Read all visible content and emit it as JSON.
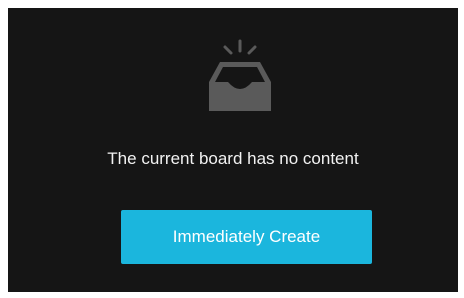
{
  "empty_state": {
    "icon": "empty-inbox-icon",
    "message": "The current board has no content",
    "create_button_label": "Immediately Create"
  },
  "colors": {
    "background": "#151515",
    "icon": "#5a5a5a",
    "button": "#1bb6dd",
    "text": "#f2f2f2"
  }
}
